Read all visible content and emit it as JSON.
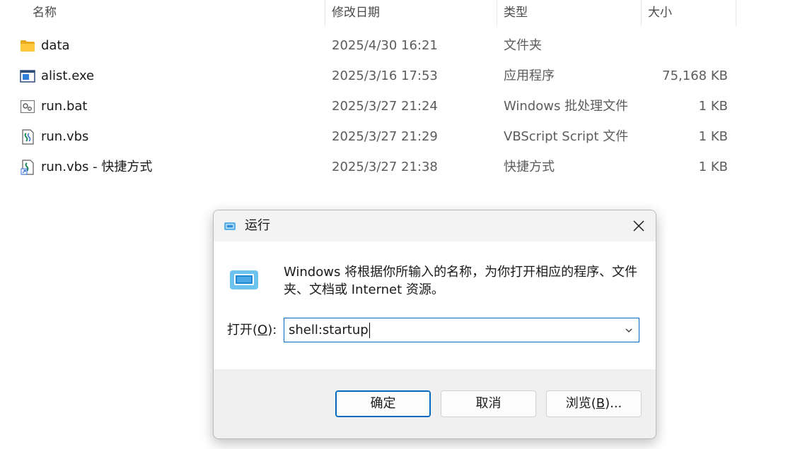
{
  "explorer": {
    "columns": {
      "name": "名称",
      "date": "修改日期",
      "type": "类型",
      "size": "大小"
    },
    "files": [
      {
        "icon": "folder-icon",
        "name": "data",
        "date": "2025/4/30 16:21",
        "type": "文件夹",
        "size": ""
      },
      {
        "icon": "exe-icon",
        "name": "alist.exe",
        "date": "2025/3/16 17:53",
        "type": "应用程序",
        "size": "75,168 KB"
      },
      {
        "icon": "bat-icon",
        "name": "run.bat",
        "date": "2025/3/27 21:24",
        "type": "Windows 批处理文件",
        "size": "1 KB"
      },
      {
        "icon": "vbs-icon",
        "name": "run.vbs",
        "date": "2025/3/27 21:29",
        "type": "VBScript Script 文件",
        "size": "1 KB"
      },
      {
        "icon": "shortcut-icon",
        "name": "run.vbs - 快捷方式",
        "date": "2025/3/27 21:38",
        "type": "快捷方式",
        "size": "1 KB"
      }
    ]
  },
  "run_dialog": {
    "title": "运行",
    "description": "Windows 将根据你所输入的名称，为你打开相应的程序、文件夹、文档或 Internet 资源。",
    "open_label_prefix": "打开(",
    "open_label_key": "O",
    "open_label_suffix": "):",
    "input_value": "shell:startup",
    "ok_label": "确定",
    "cancel_label": "取消",
    "browse_prefix": "浏览(",
    "browse_key": "B",
    "browse_suffix": ")...",
    "accent_color": "#0067c0"
  }
}
